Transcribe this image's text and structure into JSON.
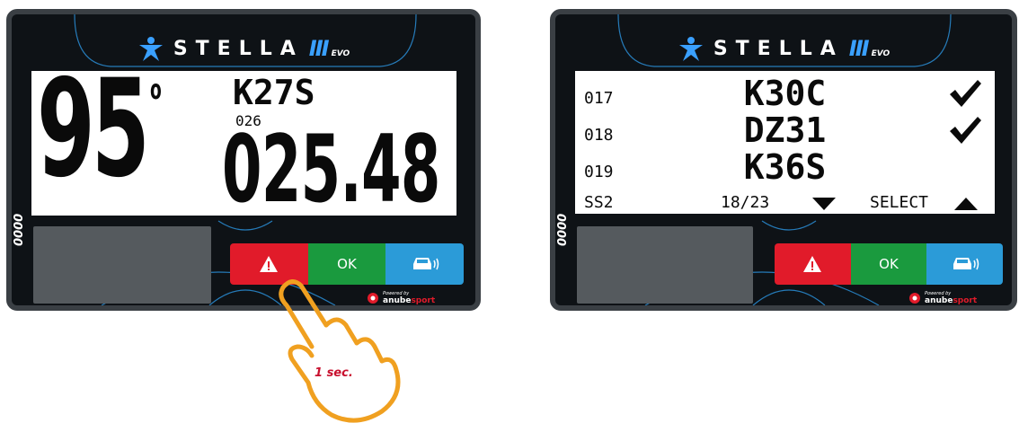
{
  "brand": {
    "wordmark": "STELLA",
    "bars": "III",
    "suffix": "EVO"
  },
  "device_left": {
    "angle": "95",
    "degree": "o",
    "code": "K27S",
    "sub": "026",
    "time": "025.48",
    "sidecode": "0000",
    "buttons": {
      "ok": "OK"
    },
    "powered": {
      "by": "Powered by",
      "brand_a": "anube",
      "brand_b": "sport"
    }
  },
  "device_right": {
    "rows": [
      {
        "idx": "017",
        "code": "K30C",
        "checked": true
      },
      {
        "idx": "018",
        "code": "DZ31",
        "checked": true
      },
      {
        "idx": "019",
        "code": "K36S",
        "checked": false
      }
    ],
    "footer": {
      "stage": "SS2",
      "page": "18/23",
      "select": "SELECT"
    },
    "sidecode": "0000",
    "buttons": {
      "ok": "OK"
    },
    "powered": {
      "by": "Powered by",
      "brand_a": "anube",
      "brand_b": "sport"
    }
  },
  "gesture": {
    "label": "1 sec."
  },
  "colors": {
    "red": "#e11b2a",
    "green": "#1a9a3e",
    "blue": "#2b9bd8",
    "accent": "#3aa0ff",
    "hand": "#f0a020"
  },
  "icons": [
    "star-person-logo-icon",
    "warning-triangle-icon",
    "car-signal-icon",
    "checkmark-icon",
    "arrow-down-icon",
    "arrow-up-icon",
    "pointing-hand-icon"
  ]
}
